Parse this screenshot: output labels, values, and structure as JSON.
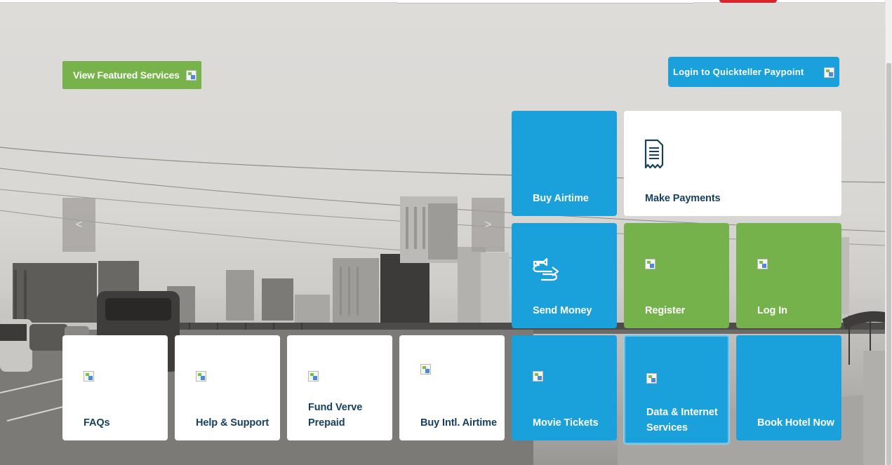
{
  "header": {
    "featured_button": "View Featured Services",
    "login_button": "Login to Quickteller Paypoint"
  },
  "slider": {
    "prev_label": "<",
    "next_label": ">"
  },
  "tiles": {
    "buy_airtime": "Buy Airtime",
    "make_payments": "Make Payments",
    "send_money": "Send Money",
    "register": "Register",
    "log_in": "Log In",
    "faqs": "FAQs",
    "help_support": "Help & Support",
    "fund_verve_prepaid": "Fund Verve Prepaid",
    "buy_intl_airtime": "Buy Intl. Airtime",
    "movie_tickets": "Movie Tickets",
    "data_internet_services": "Data & Internet Services",
    "book_hotel_now": "Book Hotel Now"
  },
  "colors": {
    "blue": "#1aa1dc",
    "green": "#76b24b",
    "white": "#ffffff",
    "dark_text": "#15415f"
  },
  "icons": {
    "make_payments": "receipt-icon",
    "send_money": "transfer-arrows-icon"
  }
}
